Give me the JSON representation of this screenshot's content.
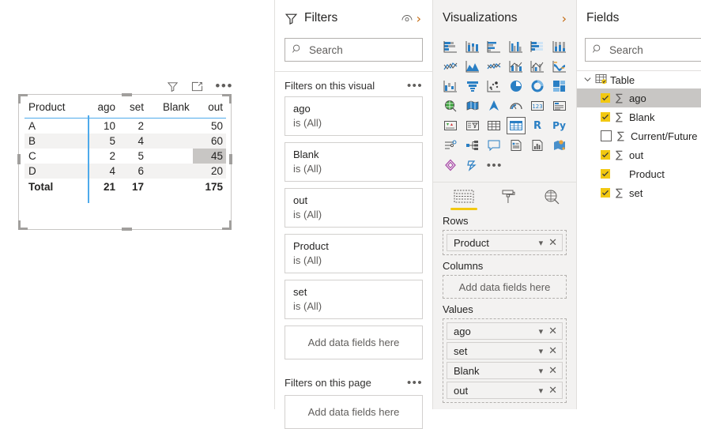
{
  "visual": {
    "header_icons": [
      "filter-icon",
      "focus-mode-icon",
      "more-options-icon"
    ],
    "table": {
      "columns": [
        "Product",
        "ago",
        "set",
        "Blank",
        "out"
      ],
      "rows": [
        {
          "Product": "A",
          "ago": "10",
          "set": "2",
          "Blank": "",
          "out": "50"
        },
        {
          "Product": "B",
          "ago": "5",
          "set": "4",
          "Blank": "",
          "out": "60"
        },
        {
          "Product": "C",
          "ago": "2",
          "set": "5",
          "Blank": "",
          "out": "45"
        },
        {
          "Product": "D",
          "ago": "4",
          "set": "6",
          "Blank": "",
          "out": "20"
        }
      ],
      "total": {
        "Product": "Total",
        "ago": "21",
        "set": "17",
        "Blank": "",
        "out": "175"
      },
      "highlighted_cell": {
        "row": "C",
        "column": "out",
        "value": "45"
      }
    }
  },
  "filters": {
    "title": "Filters",
    "search_placeholder": "Search",
    "visual_section": {
      "label": "Filters on this visual",
      "cards": [
        {
          "field": "ago",
          "condition": "is (All)"
        },
        {
          "field": "Blank",
          "condition": "is (All)"
        },
        {
          "field": "out",
          "condition": "is (All)"
        },
        {
          "field": "Product",
          "condition": "is (All)"
        },
        {
          "field": "set",
          "condition": "is (All)"
        }
      ],
      "dropzone": "Add data fields here"
    },
    "page_section": {
      "label": "Filters on this page",
      "dropzone": "Add data fields here"
    }
  },
  "visualizations": {
    "title": "Visualizations",
    "icons": [
      "stacked-bar-chart",
      "stacked-column-chart",
      "clustered-bar-chart",
      "clustered-column-chart",
      "100-stacked-bar-chart",
      "100-stacked-column-chart",
      "line-chart",
      "area-chart",
      "stacked-area-chart",
      "line-and-stacked-column-chart",
      "line-and-clustered-column-chart",
      "ribbon-chart",
      "waterfall-chart",
      "funnel-chart",
      "scatter-chart",
      "pie-chart",
      "donut-chart",
      "treemap",
      "map",
      "filled-map",
      "arcgis-map",
      "gauge",
      "card",
      "multi-row-card",
      "kpi",
      "slicer",
      "table",
      "matrix",
      "r-script-visual",
      "python-visual",
      "key-influencers",
      "decomposition-tree",
      "q-and-a",
      "smart-narrative",
      "paginated-report",
      "azure-map",
      "power-apps",
      "power-automate",
      "get-more-visuals"
    ],
    "selected_icon": "matrix",
    "well_tabs": [
      "fields-tab",
      "format-tab",
      "analytics-tab"
    ],
    "active_well_tab": "fields-tab",
    "wells": [
      {
        "label": "Rows",
        "items": [
          "Product"
        ],
        "placeholder": null
      },
      {
        "label": "Columns",
        "items": [],
        "placeholder": "Add data fields here"
      },
      {
        "label": "Values",
        "items": [
          "ago",
          "set",
          "Blank",
          "out"
        ],
        "placeholder": null
      }
    ]
  },
  "fields": {
    "title": "Fields",
    "search_placeholder": "Search",
    "table_node": "Table",
    "items": [
      {
        "name": "ago",
        "checked": true,
        "aggregate": true,
        "selected": true
      },
      {
        "name": "Blank",
        "checked": true,
        "aggregate": true,
        "selected": false
      },
      {
        "name": "Current/Future",
        "checked": false,
        "aggregate": true,
        "selected": false
      },
      {
        "name": "out",
        "checked": true,
        "aggregate": true,
        "selected": false
      },
      {
        "name": "Product",
        "checked": true,
        "aggregate": false,
        "selected": false
      },
      {
        "name": "set",
        "checked": true,
        "aggregate": true,
        "selected": false
      }
    ]
  },
  "colors": {
    "accent_yellow": "#f2c811",
    "table_divider_blue": "#4eaaeb",
    "row_alt": "#f3f2f1",
    "cell_highlight": "#c8c6c4",
    "chevron_orange": "#c46a10"
  }
}
